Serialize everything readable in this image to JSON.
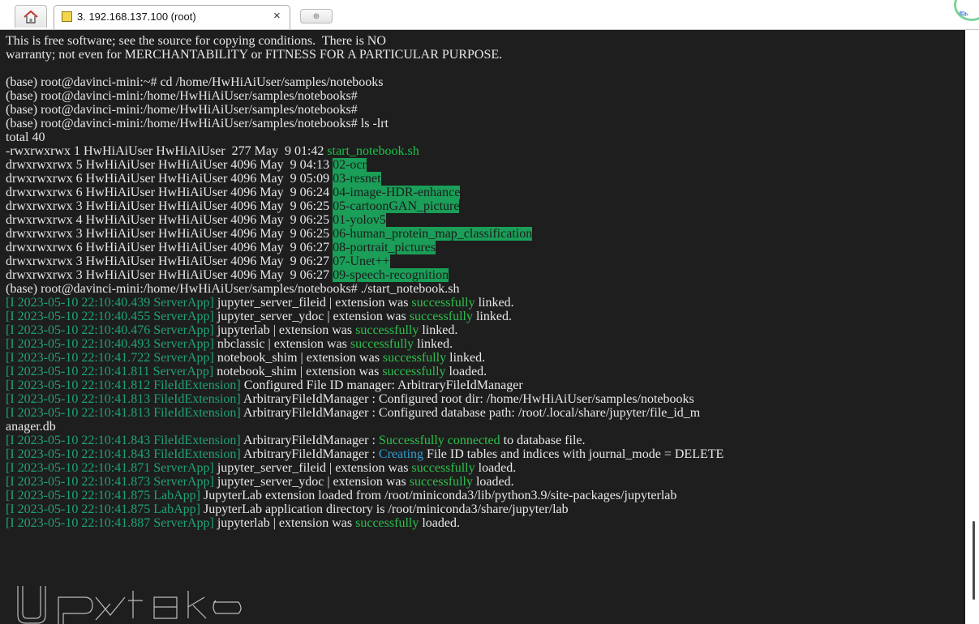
{
  "tabs": {
    "home_icon": "home-icon",
    "session_title": "3. 192.168.137.100 (root)",
    "close_glyph": "×",
    "new_tab_glyph": "⊕"
  },
  "terminal": {
    "lines": [
      {
        "segments": [
          {
            "text": "This is free software; see the source for copying conditions.  There is NO"
          }
        ]
      },
      {
        "segments": [
          {
            "text": "warranty; not even for MERCHANTABILITY or FITNESS FOR A PARTICULAR PURPOSE."
          }
        ]
      },
      {
        "segments": [
          {
            "text": ""
          }
        ]
      },
      {
        "segments": [
          {
            "text": "(base) root@davinci-mini:~# cd /home/HwHiAiUser/samples/notebooks"
          }
        ]
      },
      {
        "segments": [
          {
            "text": "(base) root@davinci-mini:/home/HwHiAiUser/samples/notebooks#"
          }
        ]
      },
      {
        "segments": [
          {
            "text": "(base) root@davinci-mini:/home/HwHiAiUser/samples/notebooks#"
          }
        ]
      },
      {
        "segments": [
          {
            "text": "(base) root@davinci-mini:/home/HwHiAiUser/samples/notebooks# ls -lrt"
          }
        ]
      },
      {
        "segments": [
          {
            "text": "total 40"
          }
        ]
      },
      {
        "segments": [
          {
            "text": "-rwxrwxrwx 1 HwHiAiUser HwHiAiUser  277 May  9 01:42 "
          },
          {
            "text": "start_notebook.sh",
            "cls": "exec"
          }
        ]
      },
      {
        "segments": [
          {
            "text": "drwxrwxrwx 5 HwHiAiUser HwHiAiUser 4096 May  9 04:13 "
          },
          {
            "text": "02-ocr",
            "cls": "dir"
          }
        ]
      },
      {
        "segments": [
          {
            "text": "drwxrwxrwx 6 HwHiAiUser HwHiAiUser 4096 May  9 05:09 "
          },
          {
            "text": "03-resnet",
            "cls": "dir"
          }
        ]
      },
      {
        "segments": [
          {
            "text": "drwxrwxrwx 6 HwHiAiUser HwHiAiUser 4096 May  9 06:24 "
          },
          {
            "text": "04-image-HDR-enhance",
            "cls": "dir"
          }
        ]
      },
      {
        "segments": [
          {
            "text": "drwxrwxrwx 3 HwHiAiUser HwHiAiUser 4096 May  9 06:25 "
          },
          {
            "text": "05-cartoonGAN_picture",
            "cls": "dir"
          }
        ]
      },
      {
        "segments": [
          {
            "text": "drwxrwxrwx 4 HwHiAiUser HwHiAiUser 4096 May  9 06:25 "
          },
          {
            "text": "01-yolov5",
            "cls": "dir"
          }
        ]
      },
      {
        "segments": [
          {
            "text": "drwxrwxrwx 3 HwHiAiUser HwHiAiUser 4096 May  9 06:25 "
          },
          {
            "text": "06-human_protein_map_classification",
            "cls": "dir"
          }
        ]
      },
      {
        "segments": [
          {
            "text": "drwxrwxrwx 6 HwHiAiUser HwHiAiUser 4096 May  9 06:27 "
          },
          {
            "text": "08-portrait_pictures",
            "cls": "dir"
          }
        ]
      },
      {
        "segments": [
          {
            "text": "drwxrwxrwx 3 HwHiAiUser HwHiAiUser 4096 May  9 06:27 "
          },
          {
            "text": "07-Unet++",
            "cls": "dir"
          }
        ]
      },
      {
        "segments": [
          {
            "text": "drwxrwxrwx 3 HwHiAiUser HwHiAiUser 4096 May  9 06:27 "
          },
          {
            "text": "09-speech-recognition",
            "cls": "dir"
          }
        ]
      },
      {
        "segments": [
          {
            "text": "(base) root@davinci-mini:/home/HwHiAiUser/samples/notebooks# ./start_notebook.sh"
          }
        ]
      },
      {
        "segments": [
          {
            "text": "[I 2023-05-10 22:10:40.439 ServerApp]",
            "cls": "log-tag"
          },
          {
            "text": " jupyter_server_fileid | extension was "
          },
          {
            "text": "successfully",
            "cls": "ok"
          },
          {
            "text": " linked."
          }
        ]
      },
      {
        "segments": [
          {
            "text": "[I 2023-05-10 22:10:40.455 ServerApp]",
            "cls": "log-tag"
          },
          {
            "text": " jupyter_server_ydoc | extension was "
          },
          {
            "text": "successfully",
            "cls": "ok"
          },
          {
            "text": " linked."
          }
        ]
      },
      {
        "segments": [
          {
            "text": "[I 2023-05-10 22:10:40.476 ServerApp]",
            "cls": "log-tag"
          },
          {
            "text": " jupyterlab | extension was "
          },
          {
            "text": "successfully",
            "cls": "ok"
          },
          {
            "text": " linked."
          }
        ]
      },
      {
        "segments": [
          {
            "text": "[I 2023-05-10 22:10:40.493 ServerApp]",
            "cls": "log-tag"
          },
          {
            "text": " nbclassic | extension was "
          },
          {
            "text": "successfully",
            "cls": "ok"
          },
          {
            "text": " linked."
          }
        ]
      },
      {
        "segments": [
          {
            "text": "[I 2023-05-10 22:10:41.722 ServerApp]",
            "cls": "log-tag"
          },
          {
            "text": " notebook_shim | extension was "
          },
          {
            "text": "successfully",
            "cls": "ok"
          },
          {
            "text": " linked."
          }
        ]
      },
      {
        "segments": [
          {
            "text": "[I 2023-05-10 22:10:41.811 ServerApp]",
            "cls": "log-tag"
          },
          {
            "text": " notebook_shim | extension was "
          },
          {
            "text": "successfully",
            "cls": "ok"
          },
          {
            "text": " loaded."
          }
        ]
      },
      {
        "segments": [
          {
            "text": "[I 2023-05-10 22:10:41.812 FileIdExtension]",
            "cls": "log-tag"
          },
          {
            "text": " Configured File ID manager: ArbitraryFileIdManager"
          }
        ]
      },
      {
        "segments": [
          {
            "text": "[I 2023-05-10 22:10:41.813 FileIdExtension]",
            "cls": "log-tag"
          },
          {
            "text": " ArbitraryFileIdManager : Configured root dir: /home/HwHiAiUser/samples/notebooks"
          }
        ]
      },
      {
        "segments": [
          {
            "text": "[I 2023-05-10 22:10:41.813 FileIdExtension]",
            "cls": "log-tag"
          },
          {
            "text": " ArbitraryFileIdManager : Configured database path: /root/.local/share/jupyter/file_id_m"
          }
        ]
      },
      {
        "segments": [
          {
            "text": "anager.db"
          }
        ]
      },
      {
        "segments": [
          {
            "text": "[I 2023-05-10 22:10:41.843 FileIdExtension]",
            "cls": "log-tag"
          },
          {
            "text": " ArbitraryFileIdManager : "
          },
          {
            "text": "Successfully connected",
            "cls": "ok"
          },
          {
            "text": " to database file."
          }
        ]
      },
      {
        "segments": [
          {
            "text": "[I 2023-05-10 22:10:41.843 FileIdExtension]",
            "cls": "log-tag"
          },
          {
            "text": " ArbitraryFileIdManager : "
          },
          {
            "text": "Creating",
            "cls": "hl-blue"
          },
          {
            "text": " File ID tables and indices with journal_mode = DELETE"
          }
        ]
      },
      {
        "segments": [
          {
            "text": "[I 2023-05-10 22:10:41.871 ServerApp]",
            "cls": "log-tag"
          },
          {
            "text": " jupyter_server_fileid | extension was "
          },
          {
            "text": "successfully",
            "cls": "ok"
          },
          {
            "text": " loaded."
          }
        ]
      },
      {
        "segments": [
          {
            "text": "[I 2023-05-10 22:10:41.873 ServerApp]",
            "cls": "log-tag"
          },
          {
            "text": " jupyter_server_ydoc | extension was "
          },
          {
            "text": "successfully",
            "cls": "ok"
          },
          {
            "text": " loaded."
          }
        ]
      },
      {
        "segments": [
          {
            "text": "[I 2023-05-10 22:10:41.875 LabApp]",
            "cls": "log-tag"
          },
          {
            "text": " JupyterLab extension loaded from /root/miniconda3/lib/python3.9/site-packages/jupyterlab"
          }
        ]
      },
      {
        "segments": [
          {
            "text": "[I 2023-05-10 22:10:41.875 LabApp]",
            "cls": "log-tag"
          },
          {
            "text": " JupyterLab application directory is /root/miniconda3/share/jupyter/lab"
          }
        ]
      },
      {
        "segments": [
          {
            "text": "[I 2023-05-10 22:10:41.887 ServerApp]",
            "cls": "log-tag"
          },
          {
            "text": " jupyterlab | extension was "
          },
          {
            "text": "successfully",
            "cls": "ok"
          },
          {
            "text": " loaded."
          }
        ]
      }
    ]
  }
}
